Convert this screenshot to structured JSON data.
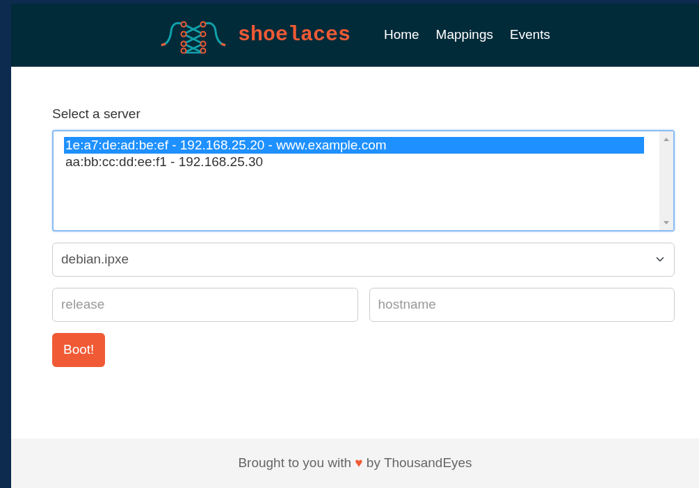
{
  "brand": "shoelaces",
  "nav": [
    {
      "label": "Home"
    },
    {
      "label": "Mappings"
    },
    {
      "label": "Events"
    }
  ],
  "server_label": "Select a server",
  "servers": [
    {
      "label": "1e:a7:de:ad:be:ef - 192.168.25.20 - www.example.com",
      "selected": true
    },
    {
      "label": "aa:bb:cc:dd:ee:f1 - 192.168.25.30",
      "selected": false
    }
  ],
  "script_select": {
    "value": "debian.ipxe"
  },
  "params": [
    {
      "placeholder": "release"
    },
    {
      "placeholder": "hostname"
    }
  ],
  "boot_button": "Boot!",
  "footer": {
    "before": "Brought to you with",
    "heart": "♥",
    "after": "by ThousandEyes"
  }
}
